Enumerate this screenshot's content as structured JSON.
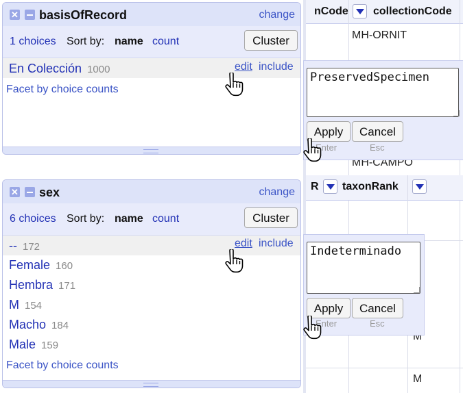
{
  "facets": [
    {
      "title": "basisOfRecord",
      "change_label": "change",
      "choices_count": "1 choices",
      "sort_by_label": "Sort by:",
      "sort_name": "name",
      "sort_count": "count",
      "cluster_label": "Cluster",
      "items": [
        {
          "name": "En Colección",
          "count": "1000",
          "edit_label": "edit",
          "include_label": "include"
        }
      ],
      "facet_by_counts": "Facet by choice counts"
    },
    {
      "title": "sex",
      "change_label": "change",
      "choices_count": "6 choices",
      "sort_by_label": "Sort by:",
      "sort_name": "name",
      "sort_count": "count",
      "cluster_label": "Cluster",
      "items": [
        {
          "name": "--",
          "count": "172",
          "edit_label": "edit",
          "include_label": "include"
        },
        {
          "name": "Female",
          "count": "160"
        },
        {
          "name": "Hembra",
          "count": "171"
        },
        {
          "name": "M",
          "count": "154"
        },
        {
          "name": "Macho",
          "count": "184"
        },
        {
          "name": "Male",
          "count": "159"
        }
      ],
      "facet_by_counts": "Facet by choice counts"
    }
  ],
  "grid": {
    "col_partial_1": "nCode",
    "col_collection": "collectionCode",
    "cell_1": "MH-ORNIT",
    "cell_2": "MH-CAMPO",
    "col_partial_2": "R",
    "col_taxon": "taxonRank",
    "cell_m1": "M",
    "cell_m2": "M"
  },
  "popups": [
    {
      "value": "PreservedSpecimen",
      "apply_label": "Apply",
      "cancel_label": "Cancel",
      "apply_hint": "Enter",
      "cancel_hint": "Esc"
    },
    {
      "value": "Indeterminado",
      "apply_label": "Apply",
      "cancel_label": "Cancel",
      "apply_hint": "Enter",
      "cancel_hint": "Esc"
    }
  ],
  "icons": {
    "close": "close-icon",
    "collapse": "minus-icon",
    "dropdown": "chevron-down-icon",
    "cursor": "hand-pointer-icon"
  }
}
